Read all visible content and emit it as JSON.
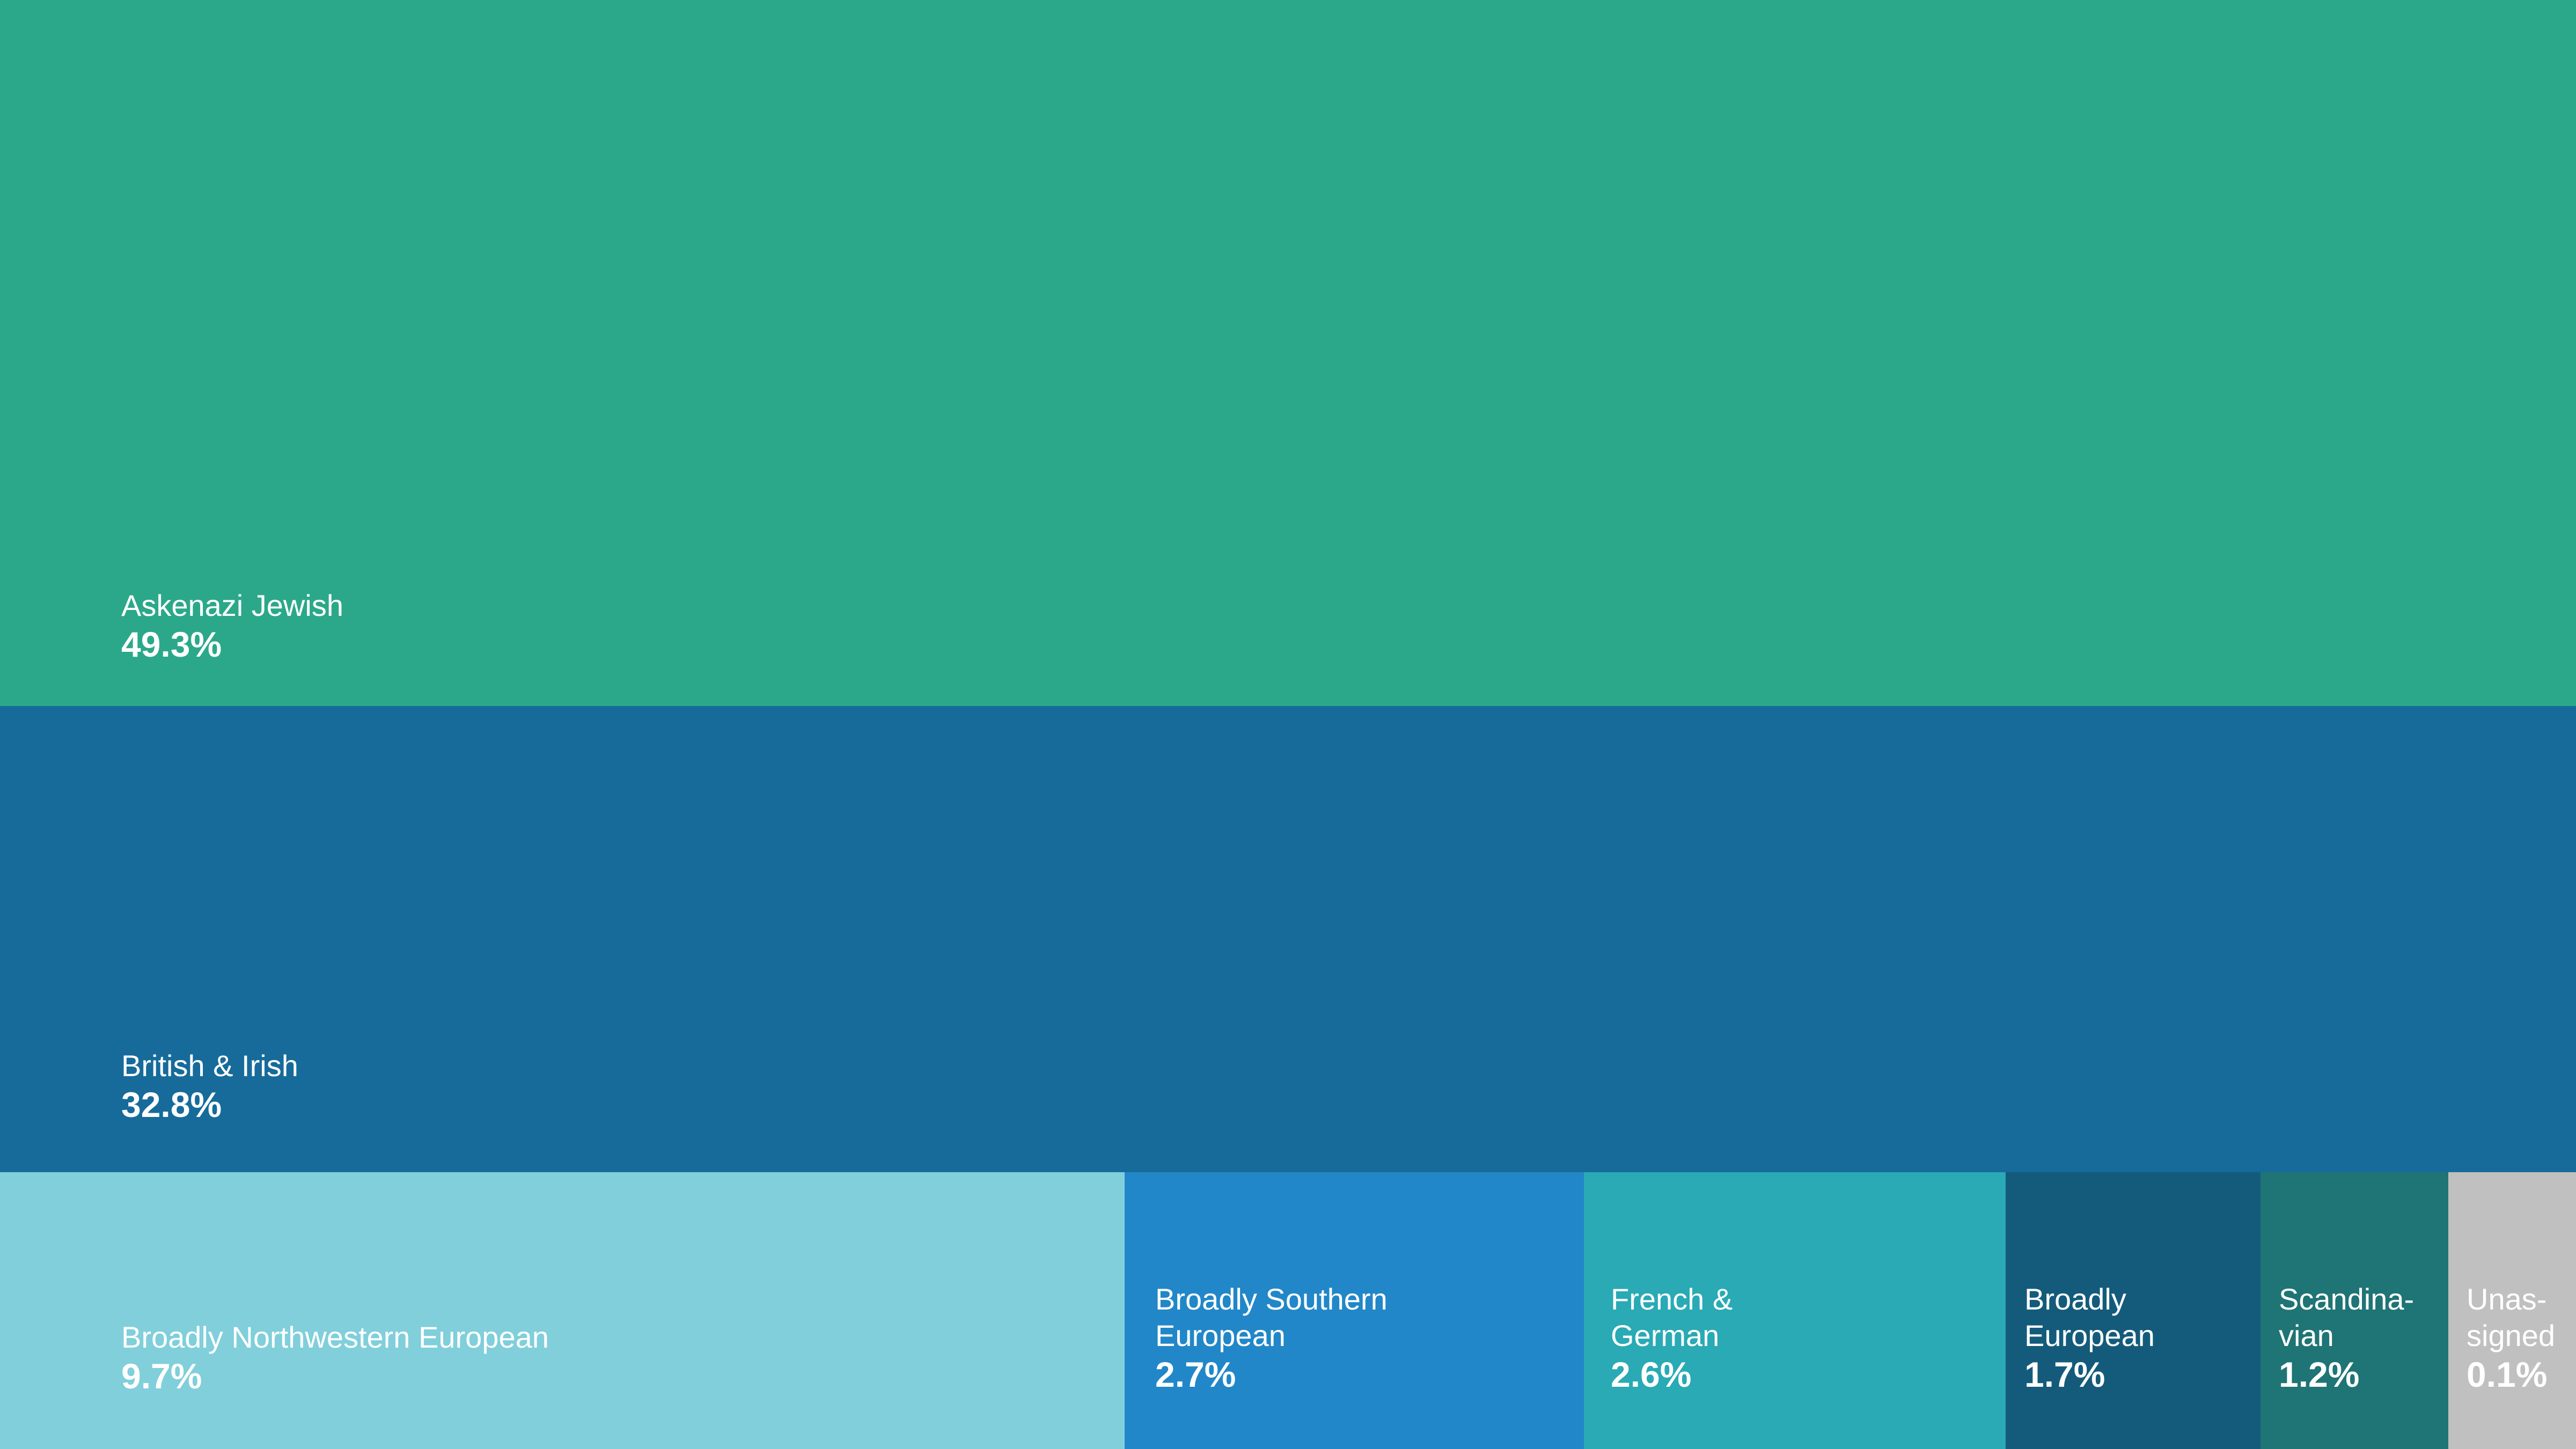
{
  "chart_data": {
    "type": "treemap",
    "title": "",
    "unit": "%",
    "items": [
      {
        "label": "Askenazi Jewish",
        "value": 49.3,
        "value_label": "49.3%",
        "color": "#2BA88A"
      },
      {
        "label": "British & Irish",
        "value": 32.8,
        "value_label": "32.8%",
        "color": "#166B9B"
      },
      {
        "label": "Broadly Northwestern European",
        "value": 9.7,
        "value_label": "9.7%",
        "color": "#80CFDB"
      },
      {
        "label": "Broadly Southern\nEuropean",
        "value": 2.7,
        "value_label": "2.7%",
        "color": "#2187C8"
      },
      {
        "label": "French &\nGerman",
        "value": 2.6,
        "value_label": "2.6%",
        "color": "#29AAB5"
      },
      {
        "label": "Broadly\nEuropean",
        "value": 1.7,
        "value_label": "1.7%",
        "color": "#145B7B"
      },
      {
        "label": "Scandina-\nvian",
        "value": 1.2,
        "value_label": "1.2%",
        "color": "#1F7475"
      },
      {
        "label": "Unas-\nsigned",
        "value": 0.1,
        "value_label": "0.1%",
        "color": "#C0C0C0"
      }
    ]
  }
}
